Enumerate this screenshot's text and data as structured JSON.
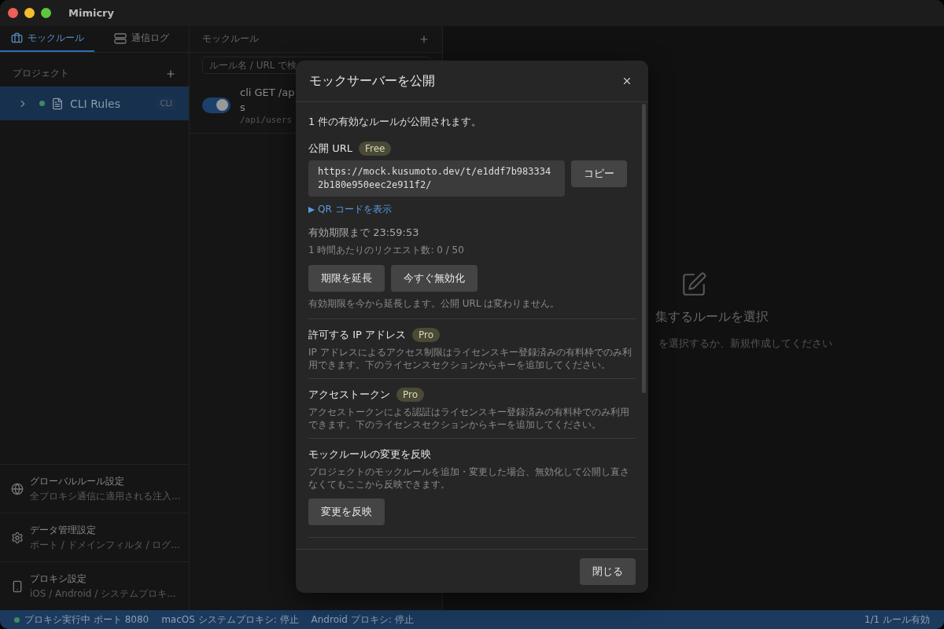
{
  "window": {
    "title": "Mimicry"
  },
  "sidebar": {
    "tabs": [
      {
        "label": "モックルール",
        "selected": true
      },
      {
        "label": "通信ログ",
        "selected": false
      }
    ],
    "projects_title": "プロジェクト",
    "projects": [
      {
        "name": "CLI Rules",
        "badge": "CLI",
        "selected": true,
        "expanded": false
      }
    ],
    "settings": [
      {
        "title": "グローバルルール設定",
        "subtitle": "全プロキシ通信に適用される注入..."
      },
      {
        "title": "データ管理設定",
        "subtitle": "ポート / ドメインフィルタ / ログ..."
      },
      {
        "title": "プロキシ設定",
        "subtitle": "iOS / Android / システムプロキ..."
      }
    ]
  },
  "rules_panel": {
    "title": "モックルール",
    "search": {
      "placeholder": "ルール名 / URL で検"
    },
    "rules": [
      {
        "name": "cli GET /ap",
        "name_wrap": "s",
        "path": "/api/users",
        "enabled": true
      }
    ]
  },
  "detail": {
    "title": "集するルールを選択",
    "hint": "を選択するか、新規作成してください"
  },
  "dialog": {
    "title": "モックサーバーを公開",
    "summary": "1 件の有効なルールが公開されます。",
    "url_label": "公開 URL",
    "url_badge": "Free",
    "url": "https://mock.kusumoto.dev/t/e1ddf7b9833342b180e950eec2e911f2/",
    "copy_button": "コピー",
    "qr_toggle": {
      "label": "QR コードを表示",
      "expanded": false
    },
    "expiry": "有効期限まで 23:59:53",
    "rate": "1 時間あたりのリクエスト数: 0 / 50",
    "buttons": [
      "期限を延長",
      "今すぐ無効化"
    ],
    "note": "有効期限を今から延長します。公開 URL は変わりません。",
    "sections": [
      {
        "title": "許可する IP アドレス",
        "badge": "Pro",
        "description": "IP アドレスによるアクセス制限はライセンスキー登録済みの有料枠でのみ利用できます。下のライセンスセクションからキーを追加してください。"
      },
      {
        "title": "アクセストークン",
        "badge": "Pro",
        "description": "アクセストークンによる認証はライセンスキー登録済みの有料枠でのみ利用できます。下のライセンスセクションからキーを追加してください。"
      },
      {
        "title": "モックルールの変更を反映",
        "description": "プロジェクトのモックルールを追加・変更した場合、無効化して公開し直さなくてもここから反映できます。",
        "button": "変更を反映"
      }
    ],
    "close_button": "閉じる"
  },
  "status_bar": {
    "proxy": "プロキシ実行中 ポート 8080",
    "running": true,
    "macos": "macOS システムプロキシ: 停止",
    "android": "Android プロキシ: 停止",
    "rules": "1/1 ルール有効"
  }
}
